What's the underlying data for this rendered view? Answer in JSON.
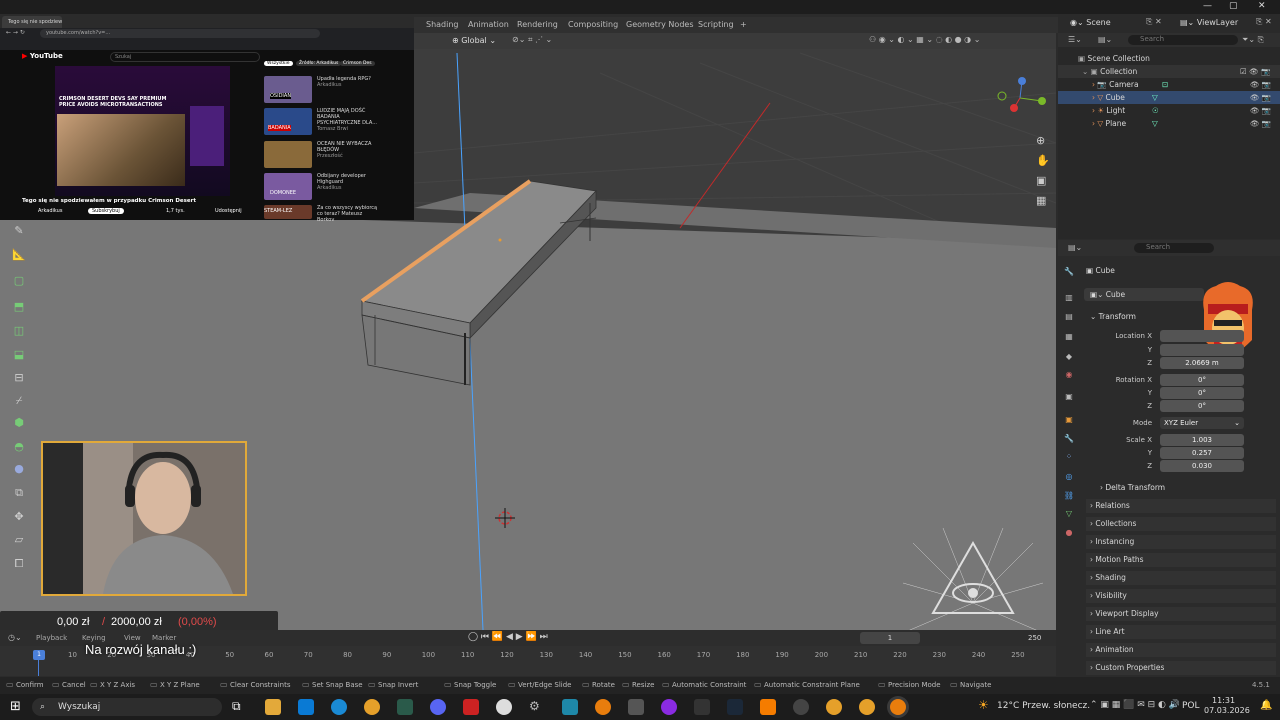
{
  "browser": {
    "tab_title": "Tego się nie spodziewałem - YouTube",
    "url": "youtube.com/watch?v=...",
    "site": "YouTube",
    "search_placeholder": "Szukaj",
    "video_title": "Tego się nie spodziewałem w przypadku Crimson Desert",
    "channel": "Arkadikus",
    "subscribe": "Subskrybuj",
    "likes": "1,7 tys.",
    "share": "Udostępnij",
    "thumb_headline": "CRIMSON DESERT DEVS SAY PREMIUM PRICE AVOIDS MICROTRANSACTIONS",
    "filters": [
      "Wszystkie",
      "Źródło: Arkadikus",
      "Crimson Des"
    ],
    "sidebar_videos": [
      {
        "title": "Upadła legenda RPG?",
        "meta": "Arkadikus",
        "thumb": "OSIDIAN"
      },
      {
        "title": "LUDZIE MAJĄ DOŚĆ BADANIA PSYCHIATRYCZNE DLA...",
        "meta": "Tomasz Brwi",
        "thumb": "BADANIA"
      },
      {
        "title": "OCEAN NIE WYBACZA BŁĘDÓW",
        "meta": "Przeszłość",
        "thumb": ""
      },
      {
        "title": "Odbijany developer Highguard",
        "meta": "Arkadikus",
        "thumb": "DOMONEE"
      },
      {
        "title": "Za co wszyscy wybiorcą co teraz? Mateusz Borkov",
        "meta": "",
        "thumb": "STEAM-LEZ"
      }
    ]
  },
  "workspace_tabs": [
    "Shading",
    "Animation",
    "Rendering",
    "Compositing",
    "Geometry Nodes",
    "Scripting",
    "+"
  ],
  "scene": {
    "label": "Scene",
    "view_layer": "ViewLayer",
    "search": "Search"
  },
  "viewport_header": {
    "orientation": "Global"
  },
  "outliner": {
    "root": "Scene Collection",
    "collection": "Collection",
    "items": [
      "Camera",
      "Cube",
      "Light",
      "Plane"
    ]
  },
  "properties": {
    "search": "Search",
    "object_name": "Cube",
    "data_name": "Cube",
    "transform": "Transform",
    "location": {
      "label": "Location X",
      "x": "",
      "y": "",
      "z": "2.0669 m"
    },
    "rotation": {
      "label": "Rotation X",
      "x": "0°",
      "y": "0°",
      "z": "0°"
    },
    "mode_label": "Mode",
    "mode_value": "XYZ Euler",
    "scale": {
      "label": "Scale X",
      "x": "1.003",
      "y": "0.257",
      "z": "0.030"
    },
    "axis_y": "Y",
    "axis_z": "Z",
    "delta": "Delta Transform",
    "panels": [
      "Relations",
      "Collections",
      "Instancing",
      "Motion Paths",
      "Shading",
      "Visibility",
      "Viewport Display",
      "Line Art",
      "Animation",
      "Custom Properties"
    ]
  },
  "donation": {
    "current": "0,00 zł",
    "slash": "/",
    "goal": "2000,00 zł",
    "percent": "(0,00%)",
    "caption": "Na rozwój kanału :)"
  },
  "timeline": {
    "menus": [
      "Playback",
      "Keying",
      "View",
      "Marker"
    ],
    "current_frame": "1",
    "frame_marker": "1",
    "end_frame": "250",
    "ticks": [
      "10",
      "20",
      "30",
      "40",
      "50",
      "60",
      "70",
      "80",
      "90",
      "100",
      "110",
      "120",
      "130",
      "140",
      "150",
      "160",
      "170",
      "180",
      "190",
      "200",
      "210",
      "220",
      "230",
      "240",
      "250"
    ]
  },
  "statusbar": {
    "items": [
      "Confirm",
      "Cancel",
      "X Y Z Axis",
      "X Y Z Plane",
      "Clear Constraints",
      "Set Snap Base",
      "Snap Invert",
      "Snap Toggle",
      "Vert/Edge Slide",
      "Rotate",
      "Resize",
      "Automatic Constraint",
      "Automatic Constraint Plane",
      "Precision Mode",
      "Navigate"
    ],
    "version": "4.5.1"
  },
  "taskbar": {
    "search": "Wyszukaj",
    "weather": "12°C  Przew. słonecz.",
    "lang": "POL",
    "time": "11:31",
    "date": "07.03.2026"
  },
  "colors": {
    "accent": "#e1a93a",
    "selected": "#ea8c2e",
    "blue_axis": "#4aa3ff",
    "red_axis": "#c22a2a"
  }
}
